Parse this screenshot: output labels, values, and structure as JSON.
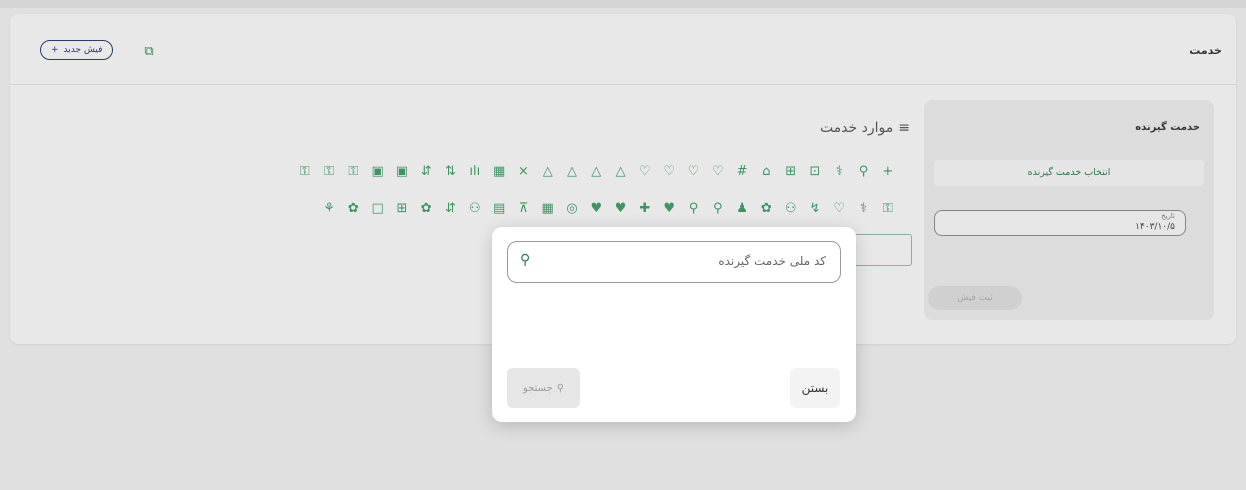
{
  "header": {
    "title": "خدمت",
    "new_receipt_label": "فیش جدید",
    "plus_glyph": "+",
    "copy_icon": "copy-icon"
  },
  "client_panel": {
    "title": "خدمت گیرنده",
    "select_label": "انتخاب خدمت گیرنده",
    "date_label": "تاریخ",
    "date_value": "۱۴۰۳/۱۰/۵",
    "submit_label": "ثبت فیش"
  },
  "services": {
    "title": "موارد خدمت",
    "toolbar_row1": [
      "+",
      "⚲",
      "⚕",
      "⊡",
      "⊞",
      "⌂",
      "#",
      "♡",
      "♡",
      "♡",
      "♡",
      "△",
      "△",
      "△",
      "△",
      "×",
      "▦",
      "ılı",
      "⇅",
      "⇵",
      "▣",
      "▣",
      "⚿",
      "⚿",
      "⚿"
    ],
    "toolbar_row2": [
      "⚿",
      "⚕",
      "♡",
      "↯",
      "⚇",
      "✿",
      "♟",
      "⚲",
      "⚲",
      "♥",
      "✚",
      "♥",
      "♥",
      "◎",
      "▦",
      "⊼",
      "▤",
      "⚇",
      "⇵",
      "✿",
      "⊞",
      "□",
      "✿",
      "⚘"
    ]
  },
  "modal": {
    "search_placeholder": "کد ملی خدمت گیرنده",
    "close_label": "بستن",
    "search_label": "جستجو"
  },
  "colors": {
    "accent": "#2e8a57",
    "navy": "#2a3a6a"
  }
}
